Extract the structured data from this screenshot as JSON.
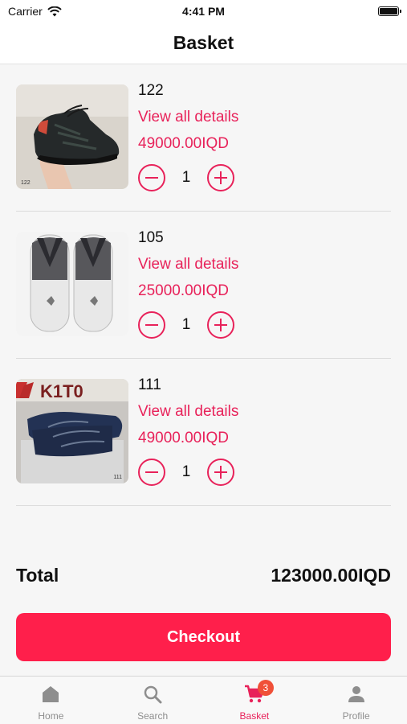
{
  "status_bar": {
    "carrier": "Carrier",
    "time": "4:41 PM"
  },
  "nav": {
    "title": "Basket"
  },
  "items": [
    {
      "name": "122",
      "link_label": "View all details",
      "price": "49000.00IQD",
      "quantity": "1",
      "image_tag": "122"
    },
    {
      "name": "105",
      "link_label": "View all details",
      "price": "25000.00IQD",
      "quantity": "1",
      "image_tag": ""
    },
    {
      "name": "111",
      "link_label": "View all details",
      "price": "49000.00IQD",
      "quantity": "1",
      "image_tag": "111"
    }
  ],
  "summary": {
    "total_label": "Total",
    "total_value": "123000.00IQD"
  },
  "checkout": {
    "label": "Checkout"
  },
  "tabs": [
    {
      "label": "Home",
      "icon": "home-icon"
    },
    {
      "label": "Search",
      "icon": "search-icon"
    },
    {
      "label": "Basket",
      "icon": "cart-icon",
      "badge": "3"
    },
    {
      "label": "Profile",
      "icon": "person-icon"
    }
  ],
  "image_text": {
    "brand_logo": "K1T0"
  },
  "colors": {
    "accent": "#e8225a",
    "checkout_button": "#ff1f4b",
    "badge": "#f05038",
    "tab_inactive": "#8e8e8e"
  }
}
